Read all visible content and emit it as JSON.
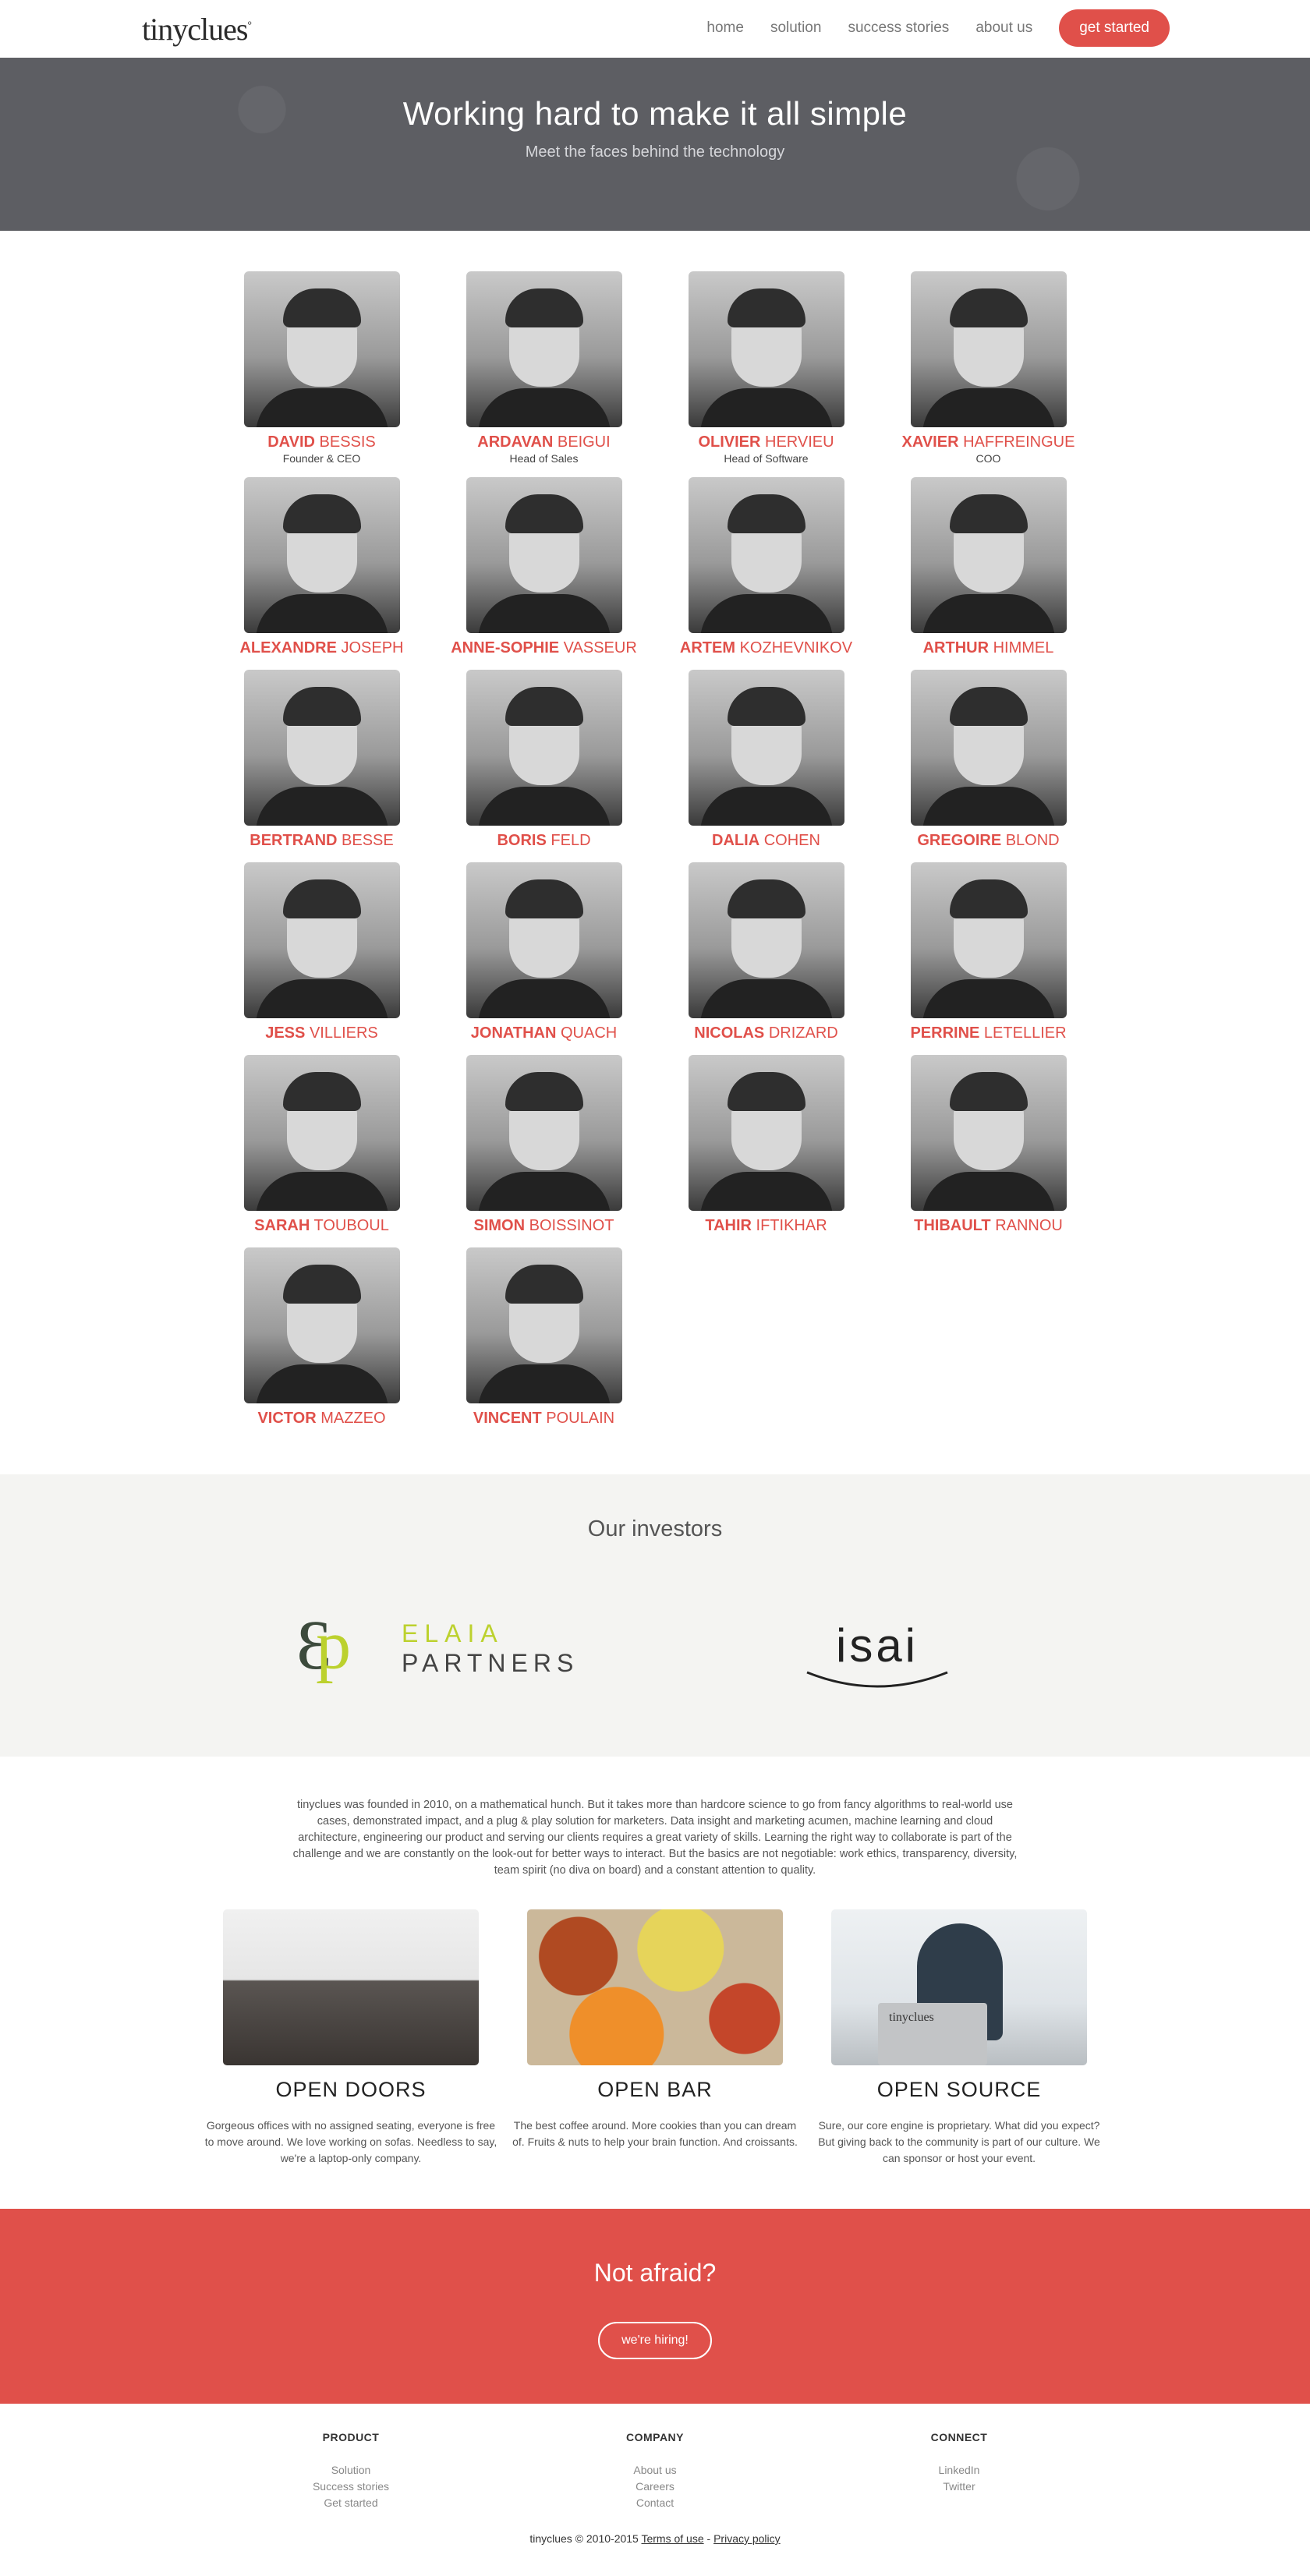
{
  "nav": {
    "logo": "tinyclues",
    "logo_mark": "°",
    "links": [
      "home",
      "solution",
      "success stories",
      "about us"
    ],
    "cta": "get started"
  },
  "hero": {
    "title": "Working hard to make it all simple",
    "subtitle": "Meet the faces behind the technology"
  },
  "team": [
    {
      "first": "DAVID",
      "last": "BESSIS",
      "role": "Founder & CEO"
    },
    {
      "first": "ARDAVAN",
      "last": "BEIGUI",
      "role": "Head of Sales"
    },
    {
      "first": "OLIVIER",
      "last": "HERVIEU",
      "role": "Head of Software"
    },
    {
      "first": "XAVIER",
      "last": "HAFFREINGUE",
      "role": "COO"
    },
    {
      "first": "ALEXANDRE",
      "last": "JOSEPH",
      "role": ""
    },
    {
      "first": "ANNE-SOPHIE",
      "last": "VASSEUR",
      "role": ""
    },
    {
      "first": "ARTEM",
      "last": "KOZHEVNIKOV",
      "role": ""
    },
    {
      "first": "ARTHUR",
      "last": "HIMMEL",
      "role": ""
    },
    {
      "first": "BERTRAND",
      "last": "BESSE",
      "role": ""
    },
    {
      "first": "BORIS",
      "last": "FELD",
      "role": ""
    },
    {
      "first": "DALIA",
      "last": "COHEN",
      "role": ""
    },
    {
      "first": "GREGOIRE",
      "last": "BLOND",
      "role": ""
    },
    {
      "first": "JESS",
      "last": "VILLIERS",
      "role": ""
    },
    {
      "first": "JONATHAN",
      "last": "QUACH",
      "role": ""
    },
    {
      "first": "NICOLAS",
      "last": "DRIZARD",
      "role": ""
    },
    {
      "first": "PERRINE",
      "last": "LETELLIER",
      "role": ""
    },
    {
      "first": "SARAH",
      "last": "TOUBOUL",
      "role": ""
    },
    {
      "first": "SIMON",
      "last": "BOISSINOT",
      "role": ""
    },
    {
      "first": "TAHIR",
      "last": "IFTIKHAR",
      "role": ""
    },
    {
      "first": "THIBAULT",
      "last": "RANNOU",
      "role": ""
    },
    {
      "first": "VICTOR",
      "last": "MAZZEO",
      "role": ""
    },
    {
      "first": "VINCENT",
      "last": "POULAIN",
      "role": ""
    }
  ],
  "investors": {
    "title": "Our investors",
    "elaia_top": "ELAIA",
    "elaia_bottom": "PARTNERS",
    "isai": "isai"
  },
  "about": {
    "text": "tinyclues was founded in 2010, on a mathematical hunch. But it takes more than hardcore science to go from fancy algorithms to real-world use cases, demonstrated impact, and a plug & play solution for marketers. Data insight and marketing acumen, machine learning and cloud architecture, engineering our product and serving our clients requires a great variety of skills. Learning the right way to collaborate is part of the challenge and we are constantly on the look-out for better ways to interact. But the basics are not negotiable: work ethics, transparency, diversity, team spirit (no diva on board) and a constant attention to quality.",
    "features": [
      {
        "title": "OPEN DOORS",
        "desc": "Gorgeous offices with no assigned seating, everyone is free to move around. We love working on sofas. Needless to say, we're a laptop-only company."
      },
      {
        "title": "OPEN BAR",
        "desc": "The best coffee around. More cookies than you can dream of. Fruits & nuts to help your brain function. And croissants."
      },
      {
        "title": "OPEN SOURCE",
        "desc": "Sure, our core engine is proprietary. What did you expect? But giving back to the community is part of our culture. We can sponsor or host your event.",
        "laptop_label": "tinyclues"
      }
    ]
  },
  "cta": {
    "title": "Not afraid?",
    "button": "we're hiring!"
  },
  "footer": {
    "columns": [
      {
        "heading": "PRODUCT",
        "links": [
          "Solution",
          "Success stories",
          "Get started"
        ]
      },
      {
        "heading": "COMPANY",
        "links": [
          "About us",
          "Careers",
          "Contact"
        ]
      },
      {
        "heading": "CONNECT",
        "links": [
          "LinkedIn",
          "Twitter"
        ]
      }
    ],
    "copyright": "tinyclues © 2010-2015",
    "terms": "Terms of use",
    "separator": "-",
    "privacy": "Privacy policy"
  },
  "colors": {
    "accent": "#e0504a",
    "hero_bg": "#5d5e63",
    "investors_bg": "#f4f4f2",
    "elaia_green": "#bcd12e"
  }
}
